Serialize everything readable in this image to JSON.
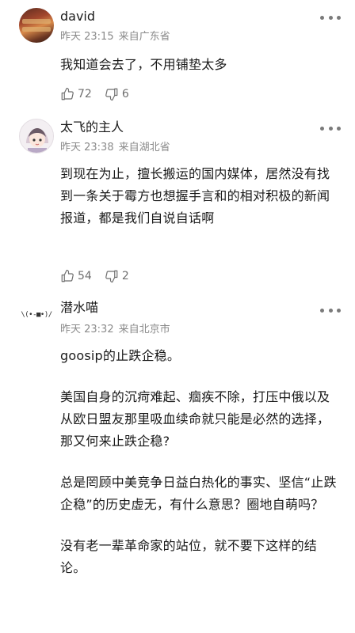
{
  "comments": [
    {
      "username": "david",
      "time": "昨天 23:15",
      "location": "来自广东省",
      "paragraphs": [
        "我知道会去了，不用铺垫太多"
      ],
      "likes": "72",
      "dislikes": "6",
      "avatar_icon": "photo-avatar"
    },
    {
      "username": "太飞的主人",
      "time": "昨天 23:38",
      "location": "来自湖北省",
      "paragraphs": [
        "到现在为止，擅长搬运的国内媒体，居然没有找到一条关于霉方也想握手言和的相对积极的新闻报道，都是我们自说自话啊"
      ],
      "likes": "54",
      "dislikes": "2",
      "avatar_icon": "cartoon-avatar"
    },
    {
      "username": "潜水喵",
      "time": "昨天 23:32",
      "location": "来自北京市",
      "avatar_text": "\\(•-■•)/",
      "paragraphs": [
        "goosip的止跌企稳。",
        "美国自身的沉疴难起、痼疾不除，打压中俄以及从欧日盟友那里吸血续命就只能是必然的选择，那又何来止跌企稳?",
        "总是罔顾中美竞争日益白热化的事实、坚信“止跌企稳”的历史虚无，有什么意思？圈地自萌吗？",
        "没有老一辈革命家的站位，就不要下这样的结论。"
      ]
    }
  ],
  "colors": {
    "text": "#1a1a1a",
    "meta": "#8a8a8a",
    "icon": "#6f6f6f"
  }
}
